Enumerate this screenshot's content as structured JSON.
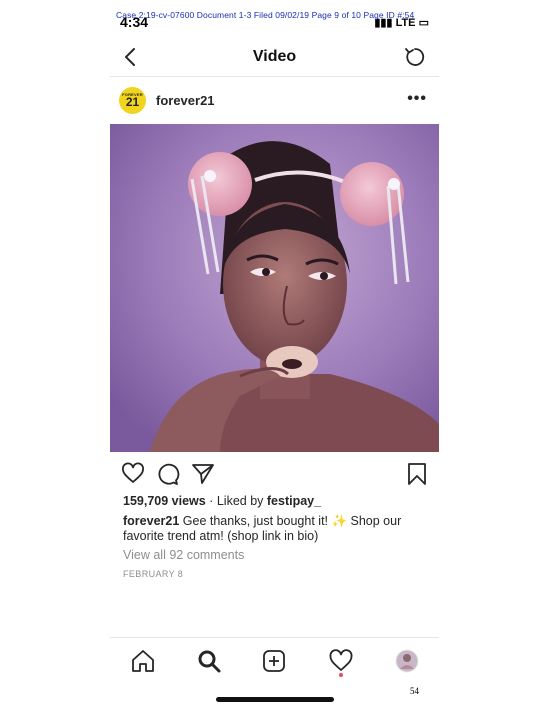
{
  "court_header": "Case 2:19-cv-07600   Document 1-3   Filed 09/02/19   Page 9 of 10   Page ID #:54",
  "status_bar": {
    "time": "4:34",
    "signal": "LTE"
  },
  "nav": {
    "title": "Video"
  },
  "post": {
    "username": "forever21",
    "avatar": {
      "small_text": "FOREVER",
      "big_text": "21",
      "color": "#f0d41e"
    },
    "views": "159,709 views",
    "liked_by_prefix": "· Liked by",
    "liked_by_user": "festipay_",
    "caption_user": "forever21",
    "caption_text": "Gee thanks, just bought it! ✨ Shop our favorite trend atm! (shop link in bio)",
    "comments_link": "View all 92 comments",
    "date": "FEBRUARY 8"
  },
  "icons": {
    "back": "chevron-left-icon",
    "refresh": "refresh-icon",
    "more": "more-options-icon",
    "like": "heart-icon",
    "comment": "comment-icon",
    "share": "send-icon",
    "save": "bookmark-icon",
    "home": "home-icon",
    "search": "search-icon",
    "new_post": "plus-square-icon",
    "activity": "heart-icon",
    "profile": "profile-avatar-icon"
  },
  "page_number": "54"
}
